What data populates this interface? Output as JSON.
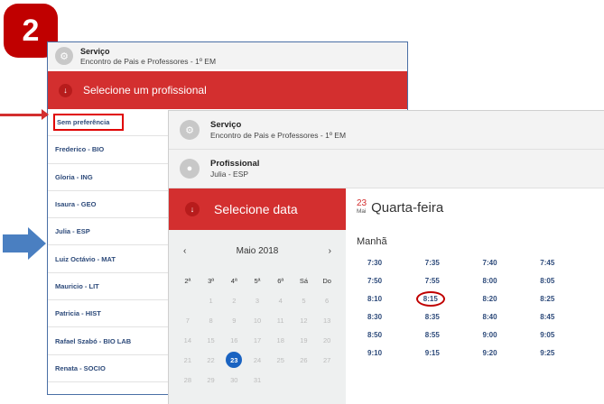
{
  "step_number": "2",
  "back_panel": {
    "service_title": "Serviço",
    "service_subtitle": "Encontro de Pais e Professores - 1º EM",
    "select_prof_label": "Selecione um profissional",
    "professionals": [
      "Sem preferência",
      "Frederico - BIO",
      "Gloria - ING",
      "Isaura - GEO",
      "Julia - ESP",
      "Luiz Octávio - MAT",
      "Mauricio - LIT",
      "Patricia - HIST",
      "Rafael Szabó - BIO LAB",
      "Renata - SOCIO"
    ]
  },
  "front_panel": {
    "service_title": "Serviço",
    "service_subtitle": "Encontro de Pais e Professores - 1º EM",
    "professional_title": "Profissional",
    "professional_value": "Julia - ESP",
    "select_date_label": "Selecione data",
    "calendar": {
      "prev": "‹",
      "next": "›",
      "month_label": "Maio 2018",
      "weekdays": [
        "2ª",
        "3ª",
        "4ª",
        "5ª",
        "6ª",
        "Sá",
        "Do"
      ],
      "weeks": [
        [
          "",
          "1",
          "2",
          "3",
          "4",
          "5",
          "6"
        ],
        [
          "7",
          "8",
          "9",
          "10",
          "11",
          "12",
          "13"
        ],
        [
          "14",
          "15",
          "16",
          "17",
          "18",
          "19",
          "20"
        ],
        [
          "21",
          "22",
          "23",
          "24",
          "25",
          "26",
          "27"
        ],
        [
          "28",
          "29",
          "30",
          "31",
          "",
          "",
          ""
        ]
      ],
      "selected_day": "23"
    },
    "selected_date": {
      "day": "23",
      "month_abbr": "Mai",
      "weekday": "Quarta-feira"
    },
    "period_label": "Manhã",
    "time_slots": [
      [
        "7:30",
        "7:35",
        "7:40",
        "7:45"
      ],
      [
        "7:50",
        "7:55",
        "8:00",
        "8:05"
      ],
      [
        "8:10",
        "8:15",
        "8:20",
        "8:25"
      ],
      [
        "8:30",
        "8:35",
        "8:40",
        "8:45"
      ],
      [
        "8:50",
        "8:55",
        "9:00",
        "9:05"
      ],
      [
        "9:10",
        "9:15",
        "9:20",
        "9:25"
      ]
    ],
    "circled_slot": "8:15"
  },
  "colors": {
    "red": "#d32f2f",
    "badge": "#c00000",
    "blue_link": "#2d4a7a",
    "selected_day": "#1a63c1",
    "pointer_arrow": "#4a7fc1"
  }
}
